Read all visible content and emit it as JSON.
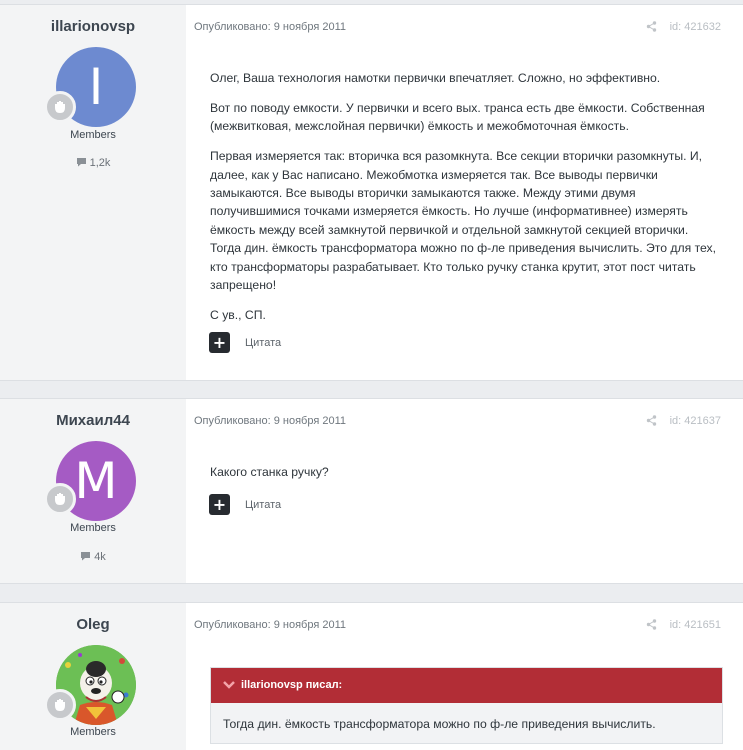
{
  "posts": [
    {
      "author": "illarionovsp",
      "avatar_letter": "I",
      "avatar_color": "#6d8ad0",
      "group": "Members",
      "count": "1,2k",
      "date": "Опубликовано: 9 ноября 2011",
      "post_id": "id: 421632",
      "paragraphs": [
        "Олег, Ваша технология намотки первички впечатляет. Сложно, но эффективно.",
        "Вот по поводу емкости. У первички и всего вых. транса есть две ёмкости. Собственная (межвитковая, межслойная первички) ёмкость и межобмоточная ёмкость.",
        "Первая измеряется так: вторичка вся разомкнута. Все секции вторички разомкнуты. И, далее, как у Вас написано. Межобмотка измеряется так. Все выводы первички замыкаются. Все выводы вторички замыкаются также. Между этими двумя получившимися точками измеряется ёмкость. Но лучше (информативнее) измерять ёмкость между всей замкнутой первичкой и отдельной замкнутой секцией вторички. Тогда дин. ёмкость трансформатора можно по ф-ле приведения вычислить. Это для тех, кто трансформаторы разрабатывает. Кто только ручку станка крутит, этот пост читать запрещено!",
        "С ув., СП."
      ],
      "quote_label": "Цитата"
    },
    {
      "author": "Михаил44",
      "avatar_letter": "M",
      "avatar_color": "#a55bc4",
      "group": "Members",
      "count": "4k",
      "date": "Опубликовано: 9 ноября 2011",
      "post_id": "id: 421637",
      "paragraphs": [
        "Какого станка ручку?"
      ],
      "quote_label": "Цитата"
    },
    {
      "author": "Oleg",
      "group": "Members",
      "date": "Опубликовано: 9 ноября 2011",
      "post_id": "id: 421651",
      "quote_author": "illarionovsp писал:",
      "quote_text": "Тогда дин. ёмкость трансформатора можно по ф-ле приведения вычислить."
    }
  ],
  "colors": {
    "accent_quote": "#b22d36",
    "sidebar_bg": "#f3f4f5"
  },
  "icons": [
    "comment-icon",
    "share-icon",
    "plus-icon",
    "rank-badge-icon",
    "chevron-down-icon"
  ]
}
